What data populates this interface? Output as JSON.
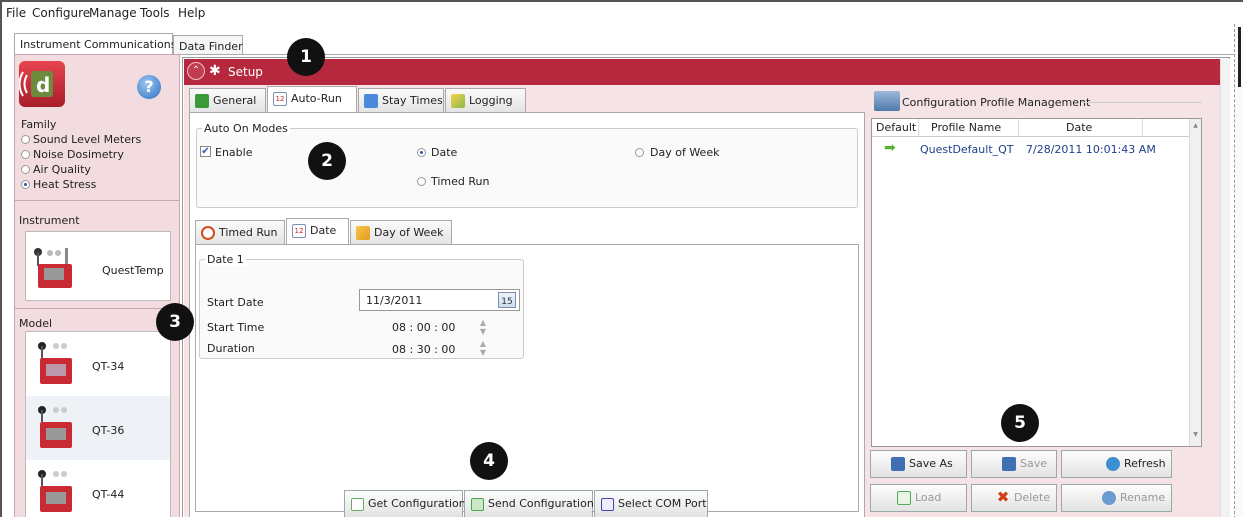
{
  "menu": [
    "File",
    "Configure",
    "Manage",
    "Tools",
    "Help"
  ],
  "top_tabs": [
    "Instrument Communications",
    "Data Finder"
  ],
  "left": {
    "family_label": "Family",
    "family_options": [
      {
        "label": "Sound Level Meters",
        "selected": false
      },
      {
        "label": "Noise Dosimetry",
        "selected": false
      },
      {
        "label": "Air Quality",
        "selected": false
      },
      {
        "label": "Heat Stress",
        "selected": true
      }
    ],
    "instrument_label": "Instrument",
    "instrument_name": "QuestTemp",
    "model_label": "Model",
    "models": [
      "QT-34",
      "QT-36",
      "QT-44"
    ]
  },
  "setup": {
    "title": "Setup",
    "tabs": [
      "General",
      "Auto-Run",
      "Stay Times",
      "Logging"
    ],
    "active_tab": "Auto-Run",
    "auto_on_modes_label": "Auto On Modes",
    "enable_label": "Enable",
    "enable_checked": true,
    "mode_options": [
      {
        "label": "Date",
        "selected": true
      },
      {
        "label": "Day of Week",
        "selected": false
      },
      {
        "label": "Timed Run",
        "selected": false
      }
    ],
    "sub_tabs": [
      "Timed Run",
      "Date",
      "Day of Week"
    ],
    "active_sub_tab": "Date",
    "date_group_label": "Date 1",
    "start_date_label": "Start Date",
    "start_date_value": "11/3/2011",
    "calendar_icon_text": "15",
    "start_time_label": "Start Time",
    "start_time_value": "08 : 00 : 00",
    "duration_label": "Duration",
    "duration_value": "08 : 30 : 00"
  },
  "bottom_buttons": [
    "Get Configuration",
    "Send Configuration",
    "Select COM Port"
  ],
  "profile": {
    "title": "Configuration Profile Management",
    "columns": [
      "Default",
      "Profile Name",
      "Date"
    ],
    "rows": [
      {
        "name": "QuestDefault_QT",
        "date": "7/28/2011 10:01:43 AM"
      }
    ],
    "buttons": [
      {
        "label": "Save As",
        "enabled": true
      },
      {
        "label": "Save",
        "enabled": false
      },
      {
        "label": "Refresh",
        "enabled": true
      },
      {
        "label": "Load",
        "enabled": false
      },
      {
        "label": "Delete",
        "enabled": false
      },
      {
        "label": "Rename",
        "enabled": false
      }
    ]
  },
  "callouts": [
    "1",
    "2",
    "3",
    "4",
    "5"
  ],
  "colors": {
    "accent": "#b5283d",
    "link_blue": "#1f3f8a",
    "panel_pink": "#f3dcdf"
  }
}
